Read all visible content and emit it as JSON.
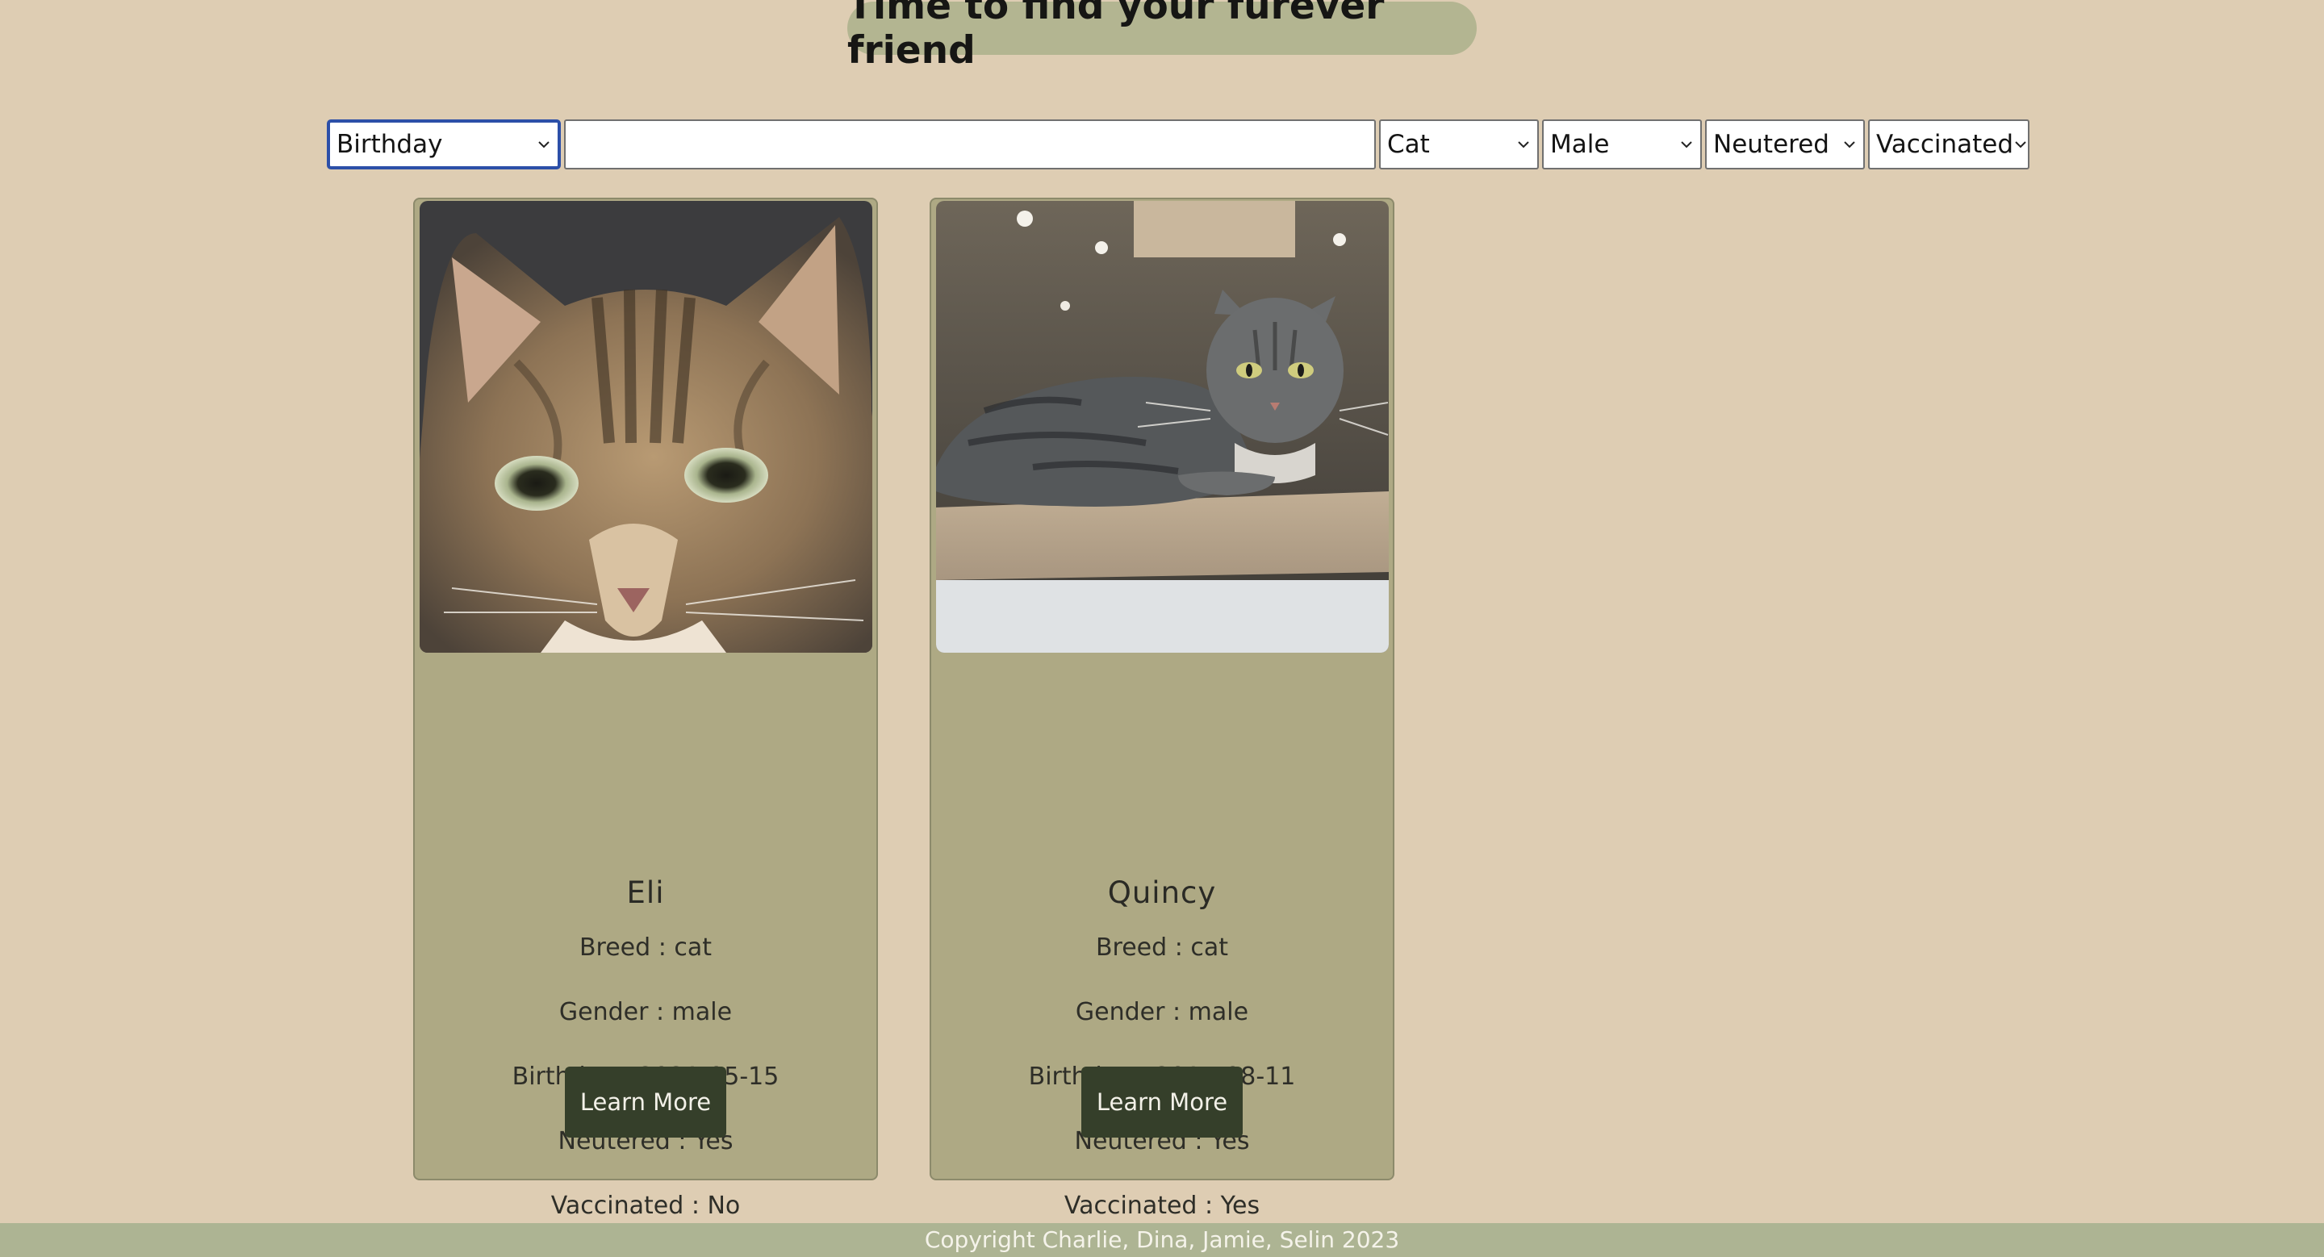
{
  "header": {
    "title": "Time to find your furever friend"
  },
  "filters": {
    "sort_selected": "Birthday",
    "search_value": "",
    "type_selected": "Cat",
    "gender_selected": "Male",
    "neutered_selected": "Neutered",
    "vaccinated_selected": "Vaccinated"
  },
  "pets": [
    {
      "name": "Eli",
      "breed": "Breed : cat",
      "gender": "Gender : male",
      "birthday": "Birthday : 2021-05-15",
      "neutered": "Neutered : Yes",
      "vaccinated": "Vaccinated : No",
      "button_label": "Learn More"
    },
    {
      "name": "Quincy",
      "breed": "Breed : cat",
      "gender": "Gender : male",
      "birthday": "Birthday : 2015-08-11",
      "neutered": "Neutered : Yes",
      "vaccinated": "Vaccinated : Yes",
      "button_label": "Learn More"
    }
  ],
  "footer": {
    "text": "Copyright Charlie, Dina, Jamie, Selin 2023"
  },
  "colors": {
    "background": "#decdb3",
    "title_pill": "#b3b591",
    "card": "#aea984",
    "button": "#353f2a",
    "footer": "#adb493"
  }
}
